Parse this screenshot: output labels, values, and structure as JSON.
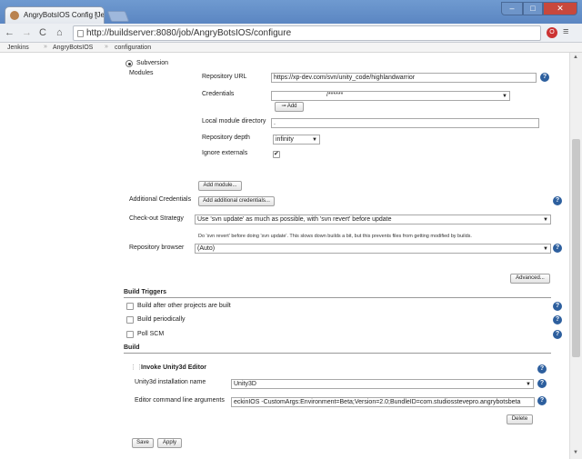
{
  "browser": {
    "tab_title": "AngryBotsIOS Config [Jen",
    "tab_close": "×",
    "url": "http://buildserver:8080/job/AngryBotsIOS/configure",
    "window": {
      "minimize": "–",
      "maximize": "□",
      "close": "✕"
    },
    "nav": {
      "back": "←",
      "forward": "→",
      "reload": "C",
      "home": "⌂",
      "menu": "≡",
      "ext": "O"
    }
  },
  "breadcrumb": {
    "items": [
      "Jenkins",
      "AngryBotsIOS",
      "configuration"
    ],
    "sep": "»"
  },
  "scm": {
    "subversion_label": "Subversion",
    "modules_label": "Modules",
    "repository_url_label": "Repository URL",
    "repository_url_value": "https://xp-dev.com/svn/unity_code/highlandwarrior",
    "credentials_label": "Credentials",
    "credentials_value": "/******",
    "add_label": "Add",
    "local_module_label": "Local module directory",
    "local_module_value": ".",
    "repository_depth_label": "Repository depth",
    "repository_depth_value": "infinity",
    "ignore_externals_label": "Ignore externals",
    "add_module_label": "Add module...",
    "additional_credentials_label": "Additional Credentials",
    "add_additional_credentials_label": "Add additional credentials...",
    "checkout_strategy_label": "Check-out Strategy",
    "checkout_strategy_value": "Use 'svn update' as much as possible, with 'svn revert' before update",
    "checkout_strategy_desc": "Do 'svn revert' before doing 'svn update'. This slows down builds a bit, but this prevents files from getting modified by builds.",
    "repository_browser_label": "Repository browser",
    "repository_browser_value": "(Auto)",
    "advanced_label": "Advanced..."
  },
  "build_triggers": {
    "title": "Build Triggers",
    "items": [
      "Build after other projects are built",
      "Build periodically",
      "Poll SCM"
    ]
  },
  "build": {
    "title": "Build",
    "step_title": "Invoke Unity3d Editor",
    "installation_label": "Unity3d installation name",
    "installation_value": "Unity3D",
    "args_label": "Editor command line arguments",
    "args_value": "eckinIOS -CustomArgs:Environment=Beta;Version=2.0;BundleID=com.studiosstevepro.angrybotsbeta",
    "delete_label": "Delete"
  },
  "footer": {
    "save_label": "Save",
    "apply_label": "Apply"
  },
  "help_glyph": "?"
}
